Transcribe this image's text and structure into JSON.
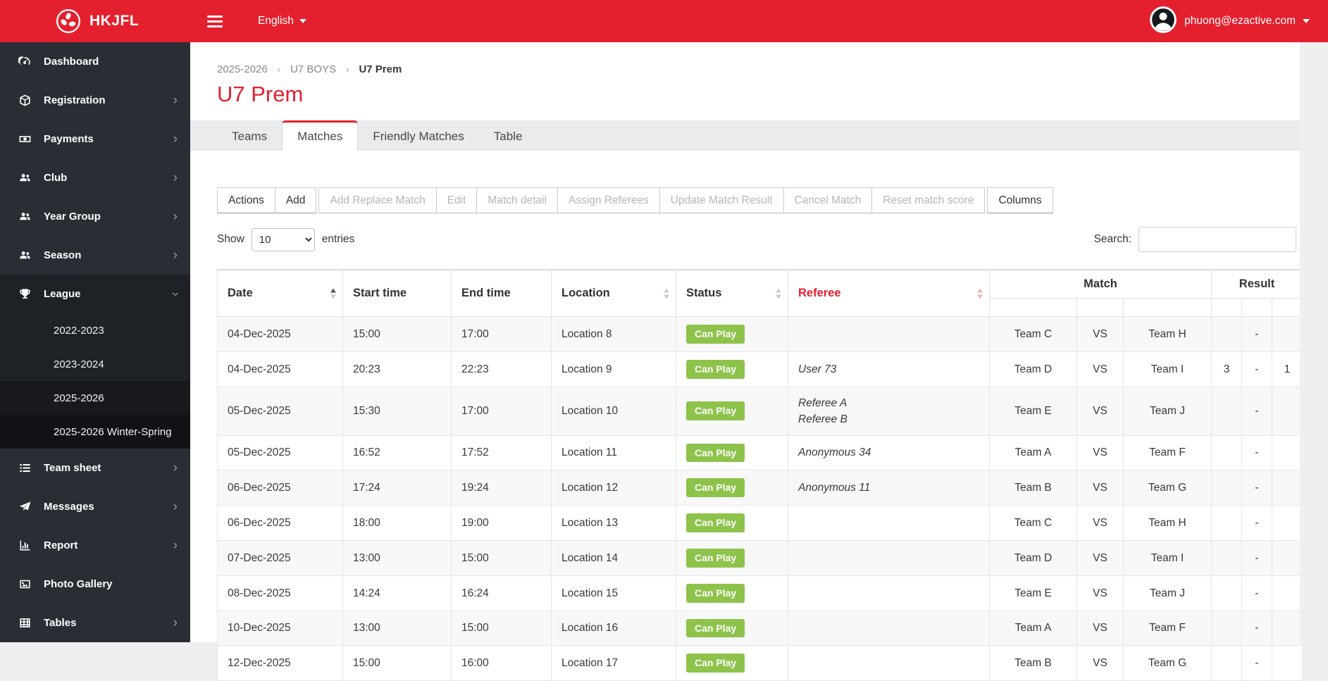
{
  "colors": {
    "accent": "#e4202e",
    "badge_green": "#8dc34b",
    "sidebar_dark": "#2a2e34"
  },
  "topbar": {
    "brand": "HKJFL",
    "language": "English",
    "user_email": "phuong@ezactive.com"
  },
  "sidebar": {
    "items": [
      {
        "label": "Dashboard",
        "icon": "dashboard",
        "chevron": null
      },
      {
        "label": "Registration",
        "icon": "cube",
        "chevron": "right"
      },
      {
        "label": "Payments",
        "icon": "money",
        "chevron": "right"
      },
      {
        "label": "Club",
        "icon": "users",
        "chevron": "right"
      },
      {
        "label": "Year Group",
        "icon": "users",
        "chevron": "right"
      },
      {
        "label": "Season",
        "icon": "users",
        "chevron": "right"
      },
      {
        "label": "League",
        "icon": "trophy",
        "chevron": "down",
        "expanded": true,
        "submenu": [
          {
            "label": "2022-2023"
          },
          {
            "label": "2023-2024"
          },
          {
            "label": "2025-2026",
            "active": true
          },
          {
            "label": "2025-2026 Winter-Spring",
            "shaded": true
          }
        ]
      },
      {
        "label": "Team sheet",
        "icon": "list",
        "chevron": "right"
      },
      {
        "label": "Messages",
        "icon": "paper-plane",
        "chevron": "right"
      },
      {
        "label": "Report",
        "icon": "chart-bar",
        "chevron": "right"
      },
      {
        "label": "Photo Gallery",
        "icon": "image",
        "chevron": null
      },
      {
        "label": "Tables",
        "icon": "table",
        "chevron": "right"
      }
    ]
  },
  "breadcrumb": [
    "2025-2026",
    "U7 BOYS",
    "U7 Prem"
  ],
  "breadcrumb_separator": "›",
  "page_title": "U7 Prem",
  "tabs": [
    {
      "label": "Teams",
      "active": false
    },
    {
      "label": "Matches",
      "active": true
    },
    {
      "label": "Friendly Matches",
      "active": false
    },
    {
      "label": "Table",
      "active": false
    }
  ],
  "toolbar": {
    "groups": [
      [
        {
          "label": "Actions",
          "enabled": true
        },
        {
          "label": "Add",
          "enabled": true
        }
      ],
      [
        {
          "label": "Add Replace Match",
          "enabled": false
        },
        {
          "label": "Edit",
          "enabled": false
        },
        {
          "label": "Match detail",
          "enabled": false
        },
        {
          "label": "Assign Referees",
          "enabled": false
        },
        {
          "label": "Update Match Result",
          "enabled": false
        },
        {
          "label": "Cancel Match",
          "enabled": false
        },
        {
          "label": "Reset match score",
          "enabled": false
        }
      ],
      [
        {
          "label": "Columns",
          "enabled": true
        }
      ]
    ]
  },
  "table_controls": {
    "show_label": "Show",
    "page_size": "10",
    "entries_label": "entries",
    "search_label": "Search:",
    "search_value": ""
  },
  "table": {
    "vs_label": "VS",
    "columns": [
      {
        "label": "Date",
        "sortable": true,
        "sort": "asc"
      },
      {
        "label": "Start time",
        "sortable": false
      },
      {
        "label": "End time",
        "sortable": false
      },
      {
        "label": "Location",
        "sortable": true,
        "sort": "none"
      },
      {
        "label": "Status",
        "sortable": true,
        "sort": "none"
      },
      {
        "label": "Referee",
        "sortable": true,
        "sort": "none",
        "red": true
      }
    ],
    "group_columns": [
      {
        "label": "Match",
        "span": 3
      },
      {
        "label": "Result",
        "span": 3
      }
    ],
    "rows": [
      {
        "date": "04-Dec-2025",
        "start_time": "15:00",
        "end_time": "17:00",
        "location": "Location 8",
        "status": "Can Play",
        "referees": [],
        "home": "Team C",
        "away": "Team H",
        "score_home": "",
        "score_sep": "-",
        "score_away": ""
      },
      {
        "date": "04-Dec-2025",
        "start_time": "20:23",
        "end_time": "22:23",
        "location": "Location 9",
        "status": "Can Play",
        "referees": [
          "User 73"
        ],
        "home": "Team D",
        "away": "Team I",
        "score_home": "3",
        "score_sep": "-",
        "score_away": "1"
      },
      {
        "date": "05-Dec-2025",
        "start_time": "15:30",
        "end_time": "17:00",
        "location": "Location 10",
        "status": "Can Play",
        "referees": [
          "Referee A",
          "Referee B"
        ],
        "home": "Team E",
        "away": "Team J",
        "score_home": "",
        "score_sep": "-",
        "score_away": ""
      },
      {
        "date": "05-Dec-2025",
        "start_time": "16:52",
        "end_time": "17:52",
        "location": "Location 11",
        "status": "Can Play",
        "referees": [
          "Anonymous 34"
        ],
        "home": "Team A",
        "away": "Team F",
        "score_home": "",
        "score_sep": "-",
        "score_away": ""
      },
      {
        "date": "06-Dec-2025",
        "start_time": "17:24",
        "end_time": "19:24",
        "location": "Location 12",
        "status": "Can Play",
        "referees": [
          "Anonymous 11"
        ],
        "home": "Team B",
        "away": "Team G",
        "score_home": "",
        "score_sep": "-",
        "score_away": ""
      },
      {
        "date": "06-Dec-2025",
        "start_time": "18:00",
        "end_time": "19:00",
        "location": "Location 13",
        "status": "Can Play",
        "referees": [],
        "home": "Team C",
        "away": "Team H",
        "score_home": "",
        "score_sep": "-",
        "score_away": ""
      },
      {
        "date": "07-Dec-2025",
        "start_time": "13:00",
        "end_time": "15:00",
        "location": "Location 14",
        "status": "Can Play",
        "referees": [],
        "home": "Team D",
        "away": "Team I",
        "score_home": "",
        "score_sep": "-",
        "score_away": ""
      },
      {
        "date": "08-Dec-2025",
        "start_time": "14:24",
        "end_time": "16:24",
        "location": "Location 15",
        "status": "Can Play",
        "referees": [],
        "home": "Team E",
        "away": "Team J",
        "score_home": "",
        "score_sep": "-",
        "score_away": ""
      },
      {
        "date": "10-Dec-2025",
        "start_time": "13:00",
        "end_time": "15:00",
        "location": "Location 16",
        "status": "Can Play",
        "referees": [],
        "home": "Team A",
        "away": "Team F",
        "score_home": "",
        "score_sep": "-",
        "score_away": ""
      },
      {
        "date": "12-Dec-2025",
        "start_time": "15:00",
        "end_time": "16:00",
        "location": "Location 17",
        "status": "Can Play",
        "referees": [],
        "home": "Team B",
        "away": "Team G",
        "score_home": "",
        "score_sep": "-",
        "score_away": ""
      }
    ]
  }
}
